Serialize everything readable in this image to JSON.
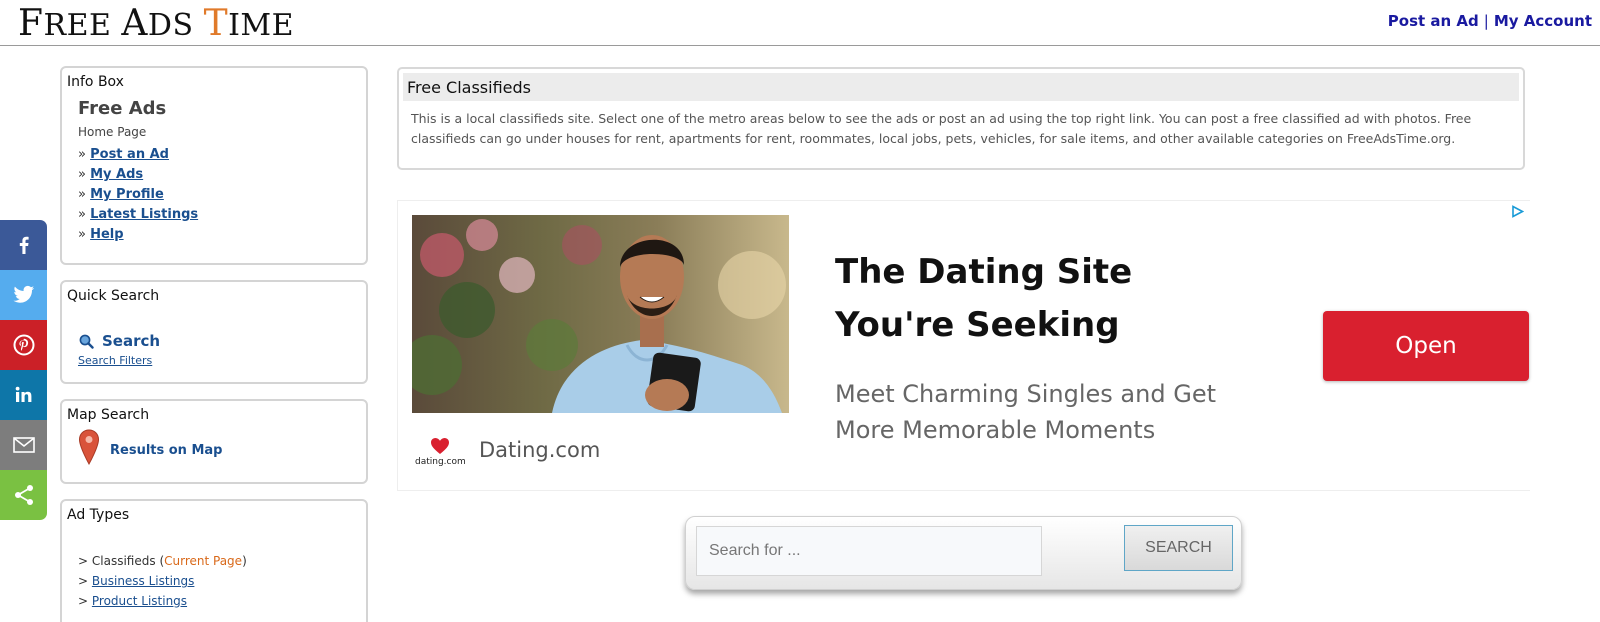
{
  "header": {
    "logo": {
      "p1": "F",
      "p2": "REE ",
      "p3": "A",
      "p4": "DS ",
      "p5": "T",
      "p6": "IME"
    },
    "links": {
      "post_ad": "Post an Ad",
      "separator": "|",
      "my_account": "My Account"
    }
  },
  "social": {
    "items": [
      "facebook-icon",
      "twitter-icon",
      "pinterest-icon",
      "linkedin-icon",
      "email-icon",
      "share-icon"
    ]
  },
  "infobox": {
    "title": "Info Box",
    "heading": "Free Ads",
    "home": "Home Page",
    "bullet": "»",
    "links": [
      "Post an Ad",
      "My Ads",
      "My Profile",
      "Latest Listings",
      "Help"
    ]
  },
  "quick_search": {
    "title": "Quick Search",
    "search_label": "Search",
    "filters_label": "Search Filters"
  },
  "map_search": {
    "title": "Map Search",
    "link_label": "Results on Map"
  },
  "ad_types": {
    "title": "Ad Types",
    "marker": ">",
    "classifieds": "Classifieds",
    "current_open": "(",
    "current_label": "Current Page",
    "current_close": ")",
    "business": "Business Listings",
    "product": "Product Listings"
  },
  "classifieds": {
    "title": "Free Classifieds",
    "text": "This is a local classifieds site. Select one of the metro areas below to see the ads or post an ad using the top right link. You can post a free classified ad with photos. Free classifieds can go under houses for rent, apartments for rent, roommates, local jobs, pets, vehicles, for sale items, and other available categories on FreeAdsTime.org."
  },
  "ad": {
    "headline": "The Dating Site You're Seeking",
    "subtext": "Meet Charming Singles and Get More Memorable Moments",
    "brand": "Dating.com",
    "logo_text": "dating.com",
    "button": "Open",
    "button_color": "#d9202f"
  },
  "bottom_search": {
    "placeholder": "Search for ...",
    "button": "SEARCH"
  },
  "colors": {
    "link_blue": "#1a4f8f",
    "header_link": "#1a1aa0",
    "logo_accent": "#e07a2a",
    "current_page": "#d9691a"
  }
}
